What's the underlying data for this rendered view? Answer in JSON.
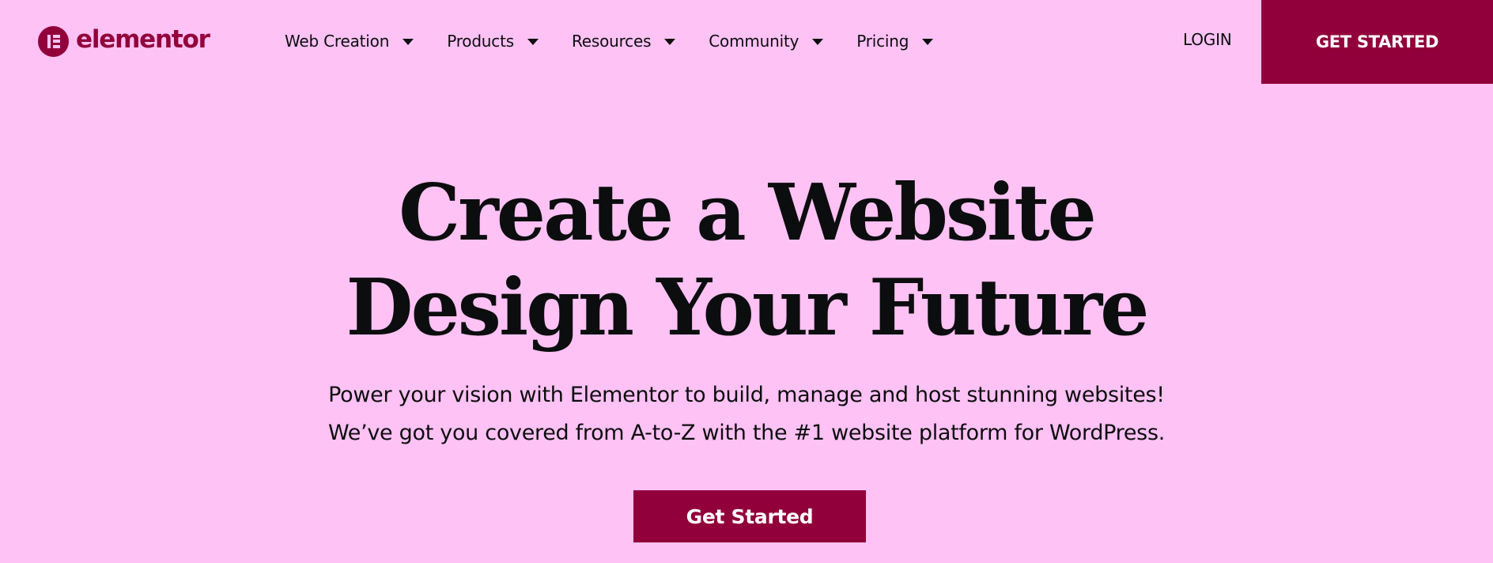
{
  "brand": {
    "name": "elementor",
    "logo_icon": "elementor-logo-icon",
    "color": "#92003B",
    "background": "#FFC2F5"
  },
  "nav": {
    "items": [
      {
        "label": "Web Creation",
        "icon": "caret-down-icon"
      },
      {
        "label": "Products",
        "icon": "caret-down-icon"
      },
      {
        "label": "Resources",
        "icon": "caret-down-icon"
      },
      {
        "label": "Community",
        "icon": "caret-down-icon"
      },
      {
        "label": "Pricing",
        "icon": "caret-down-icon"
      }
    ],
    "login_label": "LOGIN",
    "get_started_label": "GET STARTED"
  },
  "hero": {
    "title_line1": "Create a Website",
    "title_line2": "Design Your Future",
    "subtitle_line1": "Power your vision with Elementor to build, manage and host stunning websites!",
    "subtitle_line2": "We’ve got you covered from A-to-Z with the #1 website platform for WordPress.",
    "cta_label": "Get Started"
  }
}
